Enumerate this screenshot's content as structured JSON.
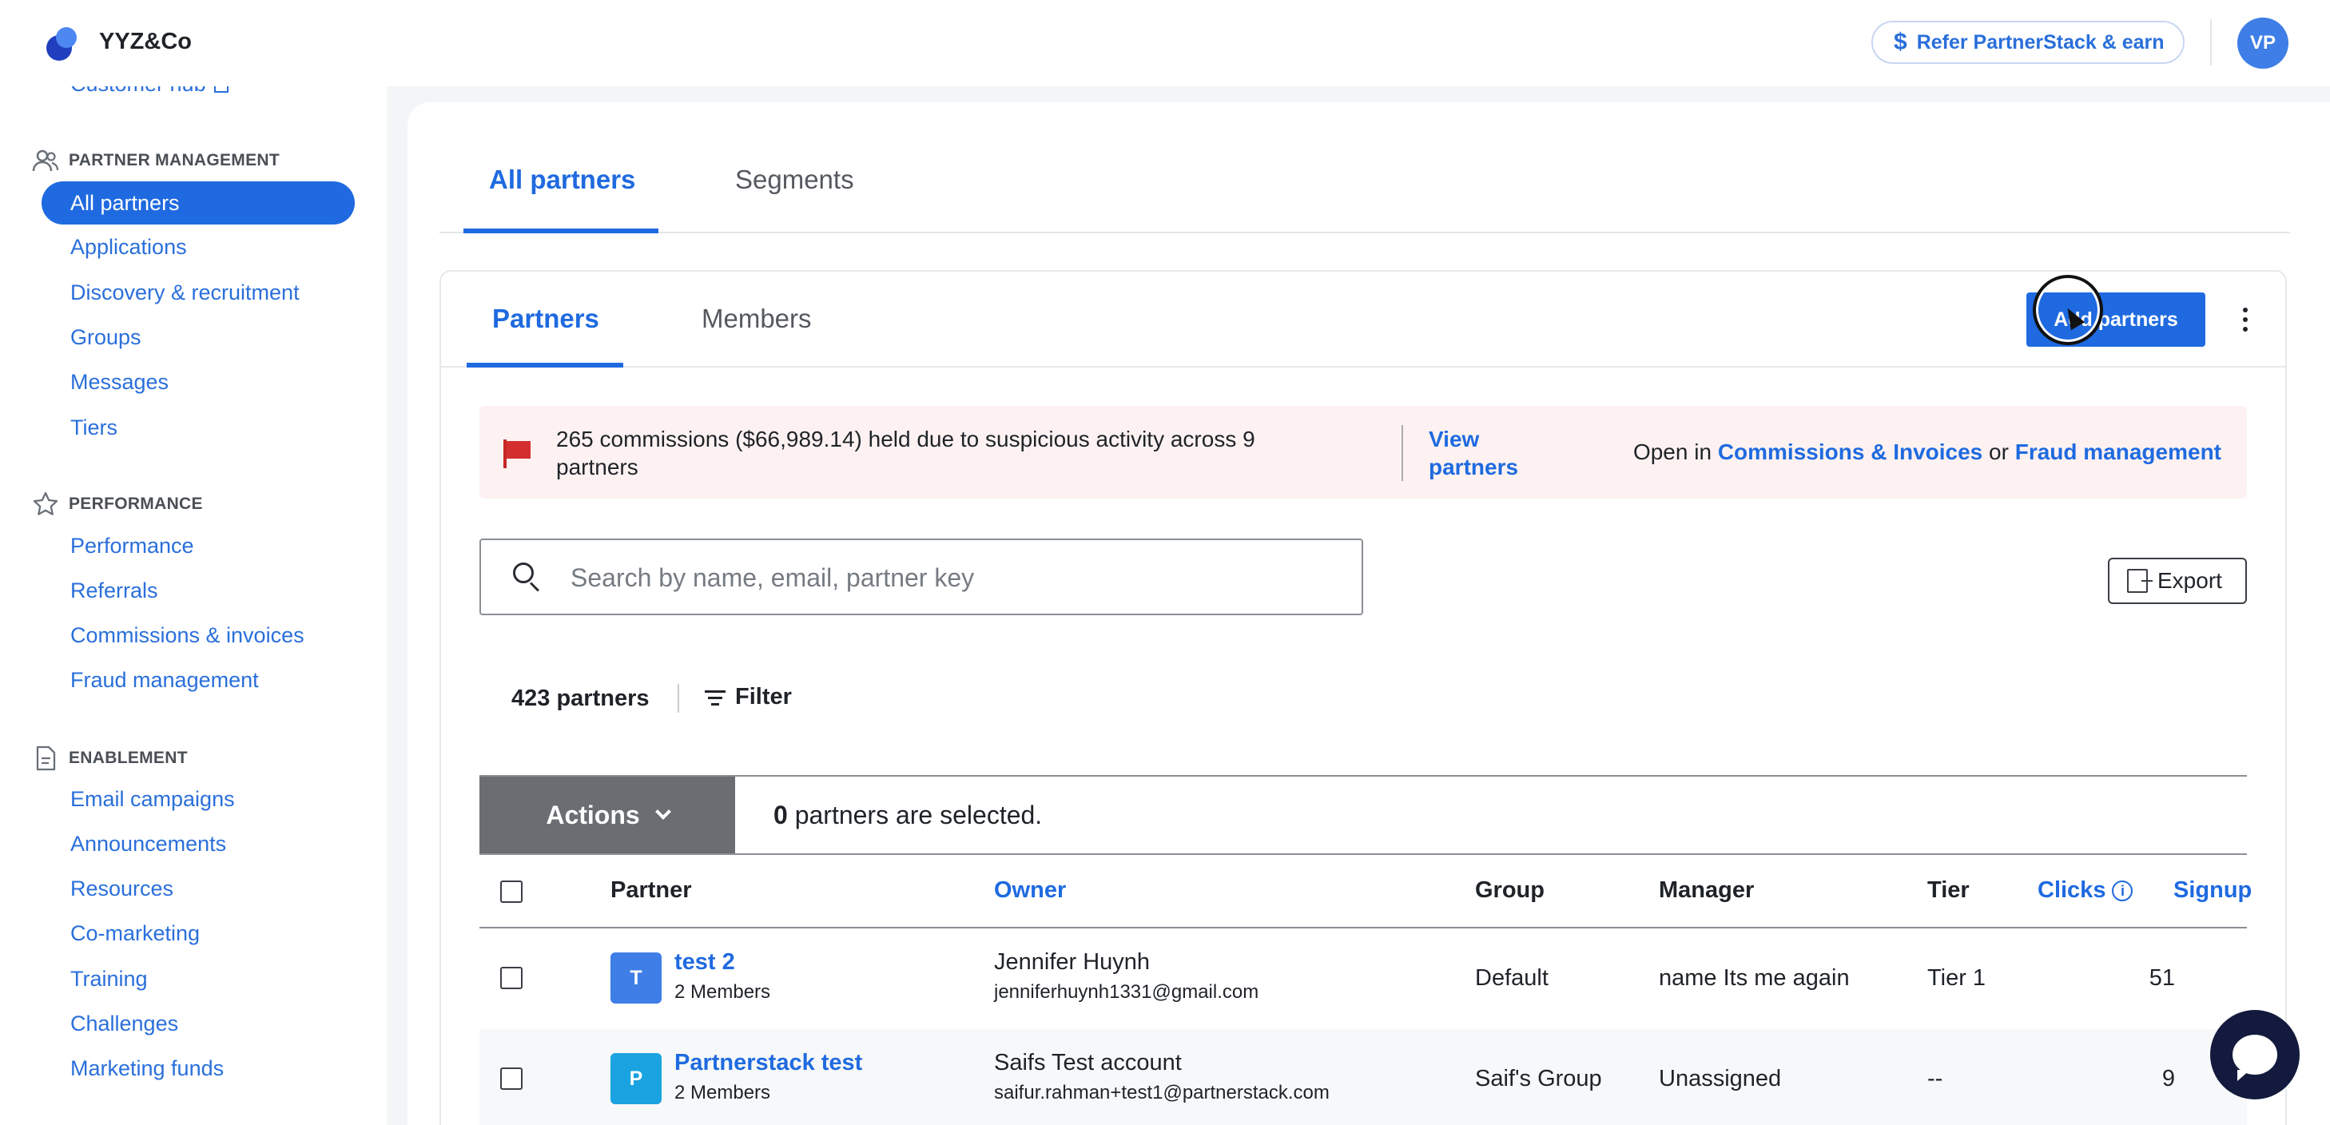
{
  "topbar": {
    "brand": "YYZ&Co",
    "refer_label": "Refer PartnerStack & earn",
    "refer_icon": "$",
    "avatar_initials": "VP"
  },
  "sidebar": {
    "cut_item": "Customer hub",
    "sections": [
      {
        "title": "PARTNER MANAGEMENT",
        "icon": "users-icon"
      },
      {
        "title": "PERFORMANCE",
        "icon": "star-icon"
      },
      {
        "title": "ENABLEMENT",
        "icon": "document-icon"
      }
    ],
    "partner_items": [
      "All partners",
      "Applications",
      "Discovery & recruitment",
      "Groups",
      "Messages",
      "Tiers"
    ],
    "performance_items": [
      "Performance",
      "Referrals",
      "Commissions & invoices",
      "Fraud management"
    ],
    "enablement_items": [
      "Email campaigns",
      "Announcements",
      "Resources",
      "Co-marketing",
      "Training",
      "Challenges",
      "Marketing funds"
    ],
    "active_item": "All partners"
  },
  "top_tabs": [
    "All partners",
    "Segments"
  ],
  "card_tabs": [
    "Partners",
    "Members"
  ],
  "add_partners_label": "Add partners",
  "alert": {
    "message": "265 commissions ($66,989.14) held due to suspicious activity across 9 partners",
    "view_link": "View partners",
    "open_prefix": "Open in",
    "link1": "Commissions & Invoices",
    "or_text": "or",
    "link2": "Fraud management"
  },
  "search": {
    "placeholder": "Search by name, email, partner key",
    "value": ""
  },
  "export_label": "Export",
  "partner_count": "423 partners",
  "filter_label": "Filter",
  "actions_label": "Actions",
  "selected": {
    "count": "0",
    "text": "partners are selected."
  },
  "table": {
    "columns": [
      "Partner",
      "Owner",
      "Group",
      "Manager",
      "Tier",
      "Clicks",
      "Signup"
    ],
    "rows": [
      {
        "initial": "T",
        "avatar_color": "#3e7ee6",
        "name": "test 2",
        "members": "2 Members",
        "owner_name": "Jennifer Huynh",
        "owner_email": "jenniferhuynh1331@gmail.com",
        "group": "Default",
        "manager": "name Its me again",
        "tier": "Tier 1",
        "clicks": "51"
      },
      {
        "initial": "P",
        "avatar_color": "#1aa3e0",
        "name": "Partnerstack test",
        "members": "2 Members",
        "owner_name": "Saifs Test account",
        "owner_email": "saifur.rahman+test1@partnerstack.com",
        "group": "Saif's Group",
        "manager": "Unassigned",
        "tier": "--",
        "clicks": "9"
      }
    ]
  },
  "colors": {
    "accent": "#1f6ae0",
    "alert_bg": "#fdf2f1",
    "flag": "#d32f2f",
    "chat_fab": "#141a3d"
  }
}
